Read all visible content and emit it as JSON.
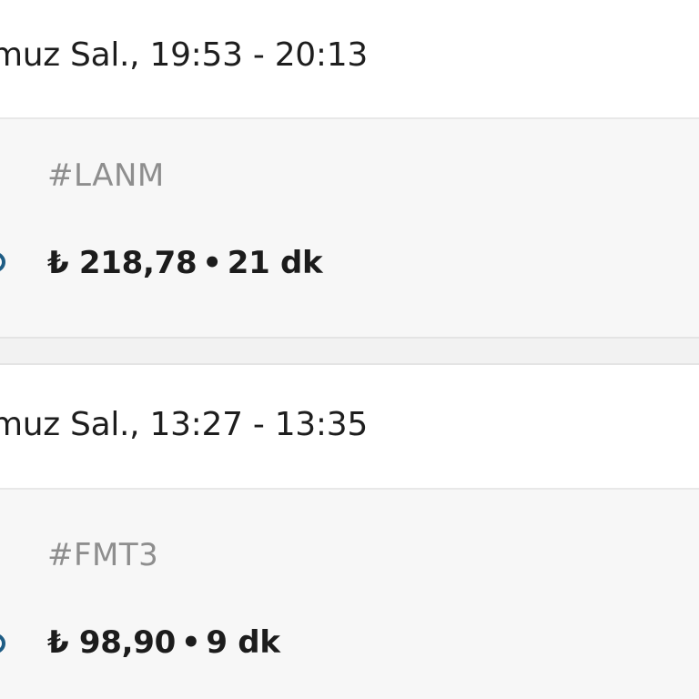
{
  "trips": [
    {
      "datetime": "muz Sal., 19:53 - 20:13",
      "code": "#LANM",
      "price": "₺ 218,78",
      "separator": "•",
      "duration": "21 dk"
    },
    {
      "datetime": "muz Sal., 13:27 - 13:35",
      "code": "#FMT3",
      "price": "₺ 98,90",
      "separator": "•",
      "duration": "9 dk"
    }
  ],
  "colors": {
    "background": "#f2f2f2",
    "card_header": "#ffffff",
    "card_body": "#f7f7f7",
    "primary_text": "#1c1c1c",
    "secondary_text": "#8e8e8e",
    "vehicle_accent": "#1f5d85"
  },
  "icons": {
    "vehicle_marker": "vehicle-dot-icon"
  }
}
